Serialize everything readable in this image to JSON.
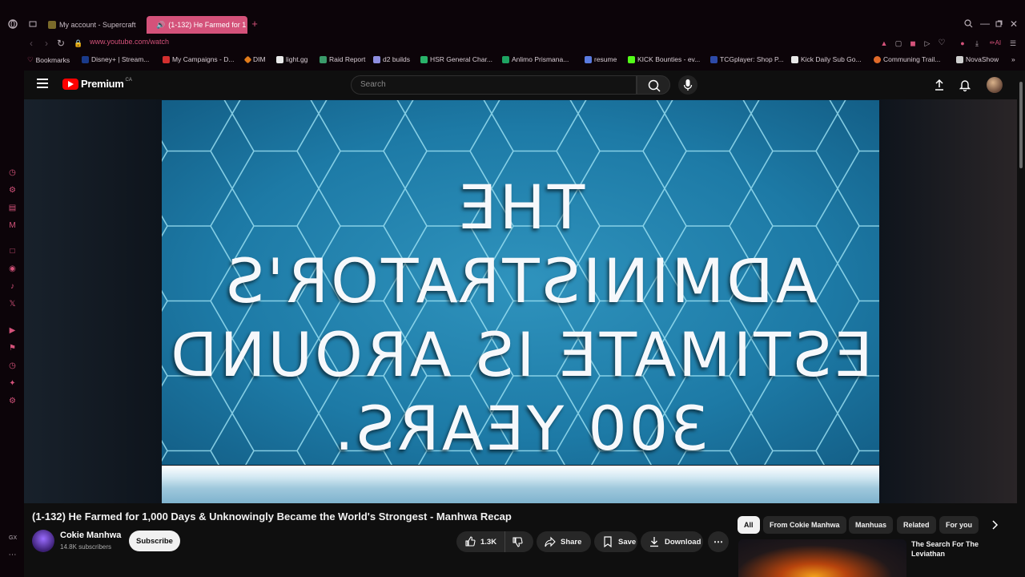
{
  "browser": {
    "tabs": [
      {
        "label": "My account - Supercraft",
        "active": false
      },
      {
        "label": "(1-132) He Farmed for 1",
        "active": true
      }
    ],
    "url": "www.youtube.com/watch",
    "bookmarks": [
      "Bookmarks",
      "Disney+ | Stream...",
      "My Campaigns - D...",
      "DIM",
      "light.gg",
      "Raid Report",
      "d2 builds",
      "HSR General Char...",
      "Anlimo Prismana...",
      "resume",
      "KICK Bounties - ev...",
      "TCGplayer: Shop P...",
      "Kick Daily Sub Go...",
      "Communing Trail...",
      "NovaShow"
    ],
    "sidebar_label": "GX"
  },
  "youtube": {
    "logo_text": "Premium",
    "country_code": "CA",
    "search_placeholder": "Search",
    "video": {
      "overlay_lines": [
        "THE ADMINISTRATOR'S",
        "ESTIMATE IS AROUND",
        "300 YEARS."
      ],
      "title": "(1-132) He Farmed for 1,000 Days & Unknowingly Became the World's Strongest - Manhwa Recap",
      "channel": "Cokie Manhwa",
      "subscribers": "14.8K subscribers",
      "subscribe_label": "Subscribe",
      "likes": "1.3K",
      "share_label": "Share",
      "save_label": "Save",
      "download_label": "Download"
    },
    "chips": [
      "All",
      "From Cokie Manhwa",
      "Manhuas",
      "Related",
      "For you"
    ],
    "recommendation": {
      "title": "The Search For The Leviathan"
    }
  },
  "colors": {
    "accent": "#d4527a",
    "youtube_red": "#ff0000",
    "video_bg": "#1d7aa6"
  }
}
